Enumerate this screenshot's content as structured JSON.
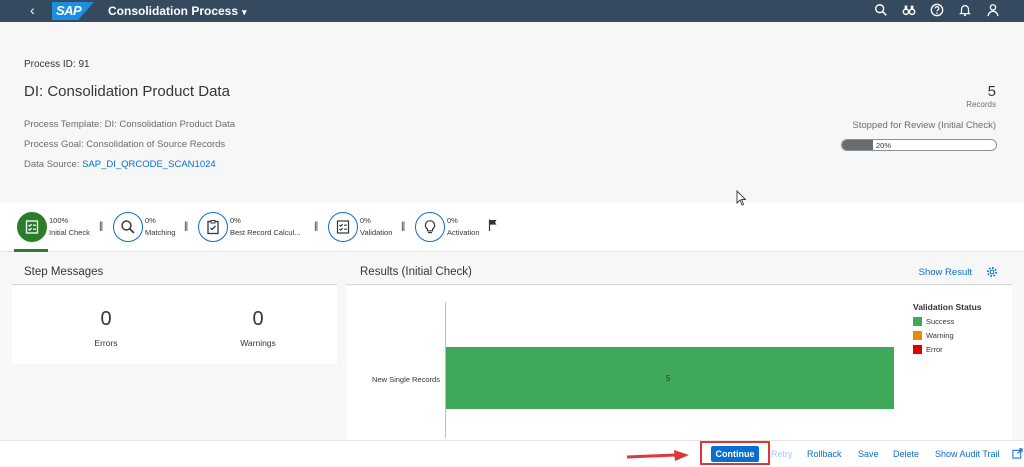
{
  "shell": {
    "back_glyph": "‹",
    "logo_text": "SAP",
    "app_title": "Consolidation Process",
    "caret": "▾",
    "icons": [
      "search-icon",
      "binoculars-icon",
      "help-icon",
      "bell-icon",
      "user-icon"
    ]
  },
  "header": {
    "process_id": "Process ID: 91",
    "title": "DI: Consolidation Product Data",
    "template": "Process Template: DI: Consolidation Product Data",
    "goal": "Process Goal: Consolidation of Source Records",
    "data_source_label": "Data Source:",
    "data_source_value": "SAP_DI_QRCODE_SCAN1024",
    "record_count": "5",
    "record_label": "Records",
    "status": "Stopped for Review (Initial Check)",
    "progress": {
      "value": 20,
      "text": "20%"
    }
  },
  "steps": [
    {
      "pct": "100%",
      "label": "Initial Check",
      "icon": "checklist-icon",
      "active": true
    },
    {
      "pct": "0%",
      "label": "Matching",
      "icon": "magnifier-icon",
      "active": false
    },
    {
      "pct": "0%",
      "label": "Best Record Calcul...",
      "icon": "clipboard-icon",
      "active": false
    },
    {
      "pct": "0%",
      "label": "Validation",
      "icon": "checklist-icon",
      "active": false
    },
    {
      "pct": "0%",
      "label": "Activation",
      "icon": "lightbulb-icon",
      "active": false
    }
  ],
  "step_separator": "||",
  "messages": {
    "title": "Step Messages",
    "errors_value": "0",
    "errors_label": "Errors",
    "warnings_value": "0",
    "warnings_label": "Warnings"
  },
  "results": {
    "title": "Results (Initial Check)",
    "show_result": "Show Result"
  },
  "chart_data": {
    "type": "bar",
    "orientation": "horizontal",
    "categories": [
      "New Single Records"
    ],
    "values": [
      5
    ],
    "data_labels": [
      "5"
    ],
    "xlim": [
      0,
      5
    ],
    "legend": {
      "title": "Validation Status",
      "placement": "right",
      "items": [
        {
          "name": "Success",
          "color": "#3fa859"
        },
        {
          "name": "Warning",
          "color": "#e78c07"
        },
        {
          "name": "Error",
          "color": "#e00000"
        }
      ]
    }
  },
  "footer": {
    "continue": "Continue",
    "retry": "Retry",
    "rollback": "Rollback",
    "save": "Save",
    "delete": "Delete",
    "audit": "Show Audit Trail"
  },
  "colors": {
    "shell": "#354a5f",
    "accent": "#0a6ed1",
    "active_step": "#2b7c2b",
    "highlight": "#e0363b"
  }
}
